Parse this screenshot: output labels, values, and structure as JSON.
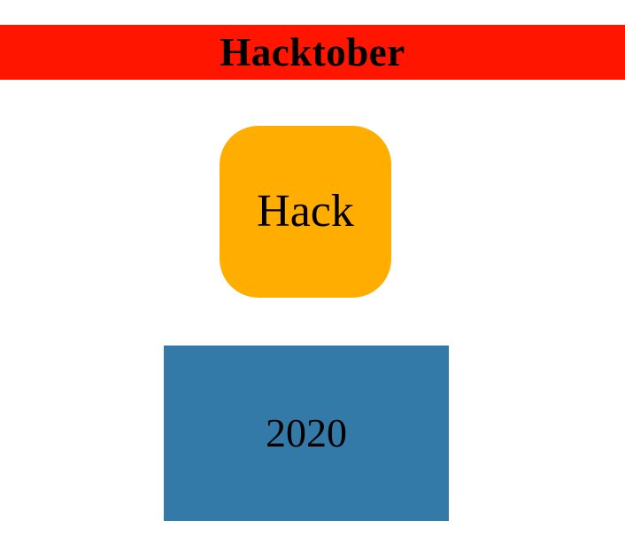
{
  "header": {
    "title": "Hacktober",
    "background_color": "#ff1500"
  },
  "hack_box": {
    "label": "Hack",
    "background_color": "#ffae00"
  },
  "year_box": {
    "label": "2020",
    "background_color": "#337aa8"
  }
}
